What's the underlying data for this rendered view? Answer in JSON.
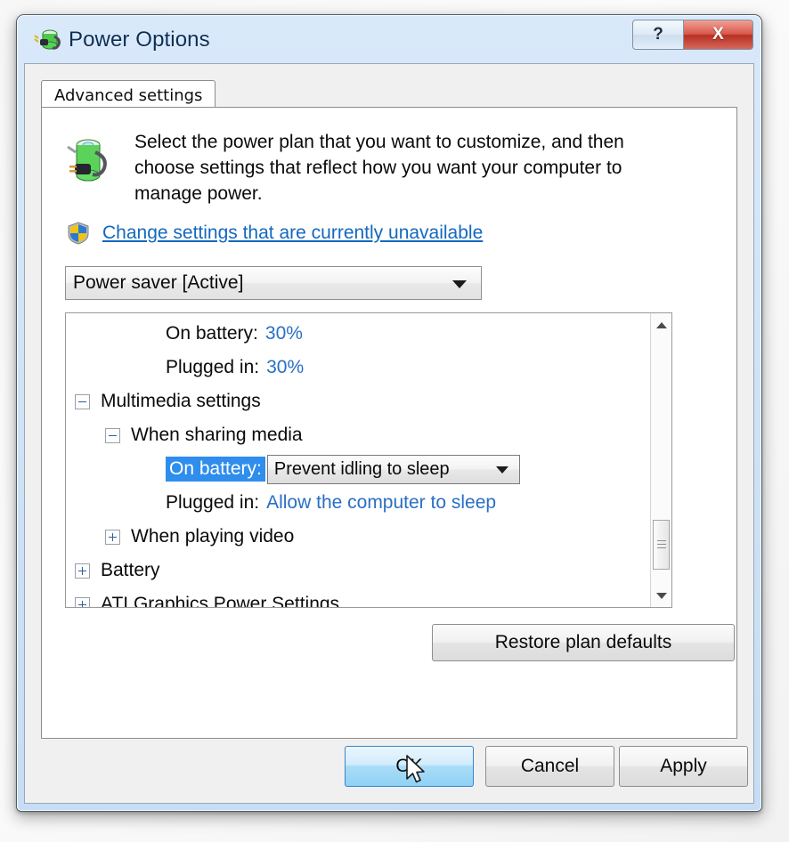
{
  "window": {
    "title": "Power Options",
    "title_icon": "battery-plug-icon",
    "help_button": "?",
    "close_button": "X"
  },
  "tab": {
    "label": "Advanced settings"
  },
  "intro": {
    "icon": "battery-plug-icon",
    "text": "Select the power plan that you want to customize, and then choose settings that reflect how you want your computer to manage power.",
    "link_icon": "uac-shield-icon",
    "link_text": "Change settings that are currently unavailable"
  },
  "plan_select": {
    "value": "Power saver [Active]",
    "caret_icon": "chevron-down-icon"
  },
  "tree": {
    "rows": [
      {
        "type": "value",
        "indent": 3,
        "label": "On battery:",
        "value": "30%",
        "selected": false
      },
      {
        "type": "value",
        "indent": 3,
        "label": "Plugged in:",
        "value": "30%",
        "selected": false
      },
      {
        "type": "group",
        "indent": 0,
        "expander": "minus",
        "label": "Multimedia settings"
      },
      {
        "type": "group",
        "indent": 1,
        "expander": "minus",
        "label": "When sharing media"
      },
      {
        "type": "combo",
        "indent": 3,
        "label": "On battery:",
        "value": "Prevent idling to sleep",
        "selected": true,
        "caret_icon": "chevron-down-icon"
      },
      {
        "type": "value",
        "indent": 3,
        "label": "Plugged in:",
        "value": "Allow the computer to sleep",
        "selected": false
      },
      {
        "type": "group",
        "indent": 1,
        "expander": "plus",
        "label": "When playing video"
      },
      {
        "type": "group",
        "indent": 0,
        "expander": "plus",
        "label": "Battery"
      },
      {
        "type": "group",
        "indent": 0,
        "expander": "plus",
        "label": "ATI Graphics Power Settings"
      }
    ],
    "scrollbar": {
      "up_icon": "scroll-up-arrow-icon",
      "down_icon": "scroll-down-arrow-icon",
      "thumb": "scroll-thumb"
    }
  },
  "buttons": {
    "restore": "Restore plan defaults",
    "ok": "OK",
    "cancel": "Cancel",
    "apply": "Apply"
  },
  "colors": {
    "link": "#1368bf",
    "value": "#2a6fc4",
    "selection": "#2e8ded",
    "title_text": "#0b2f55",
    "close_button": "#b62f22"
  }
}
